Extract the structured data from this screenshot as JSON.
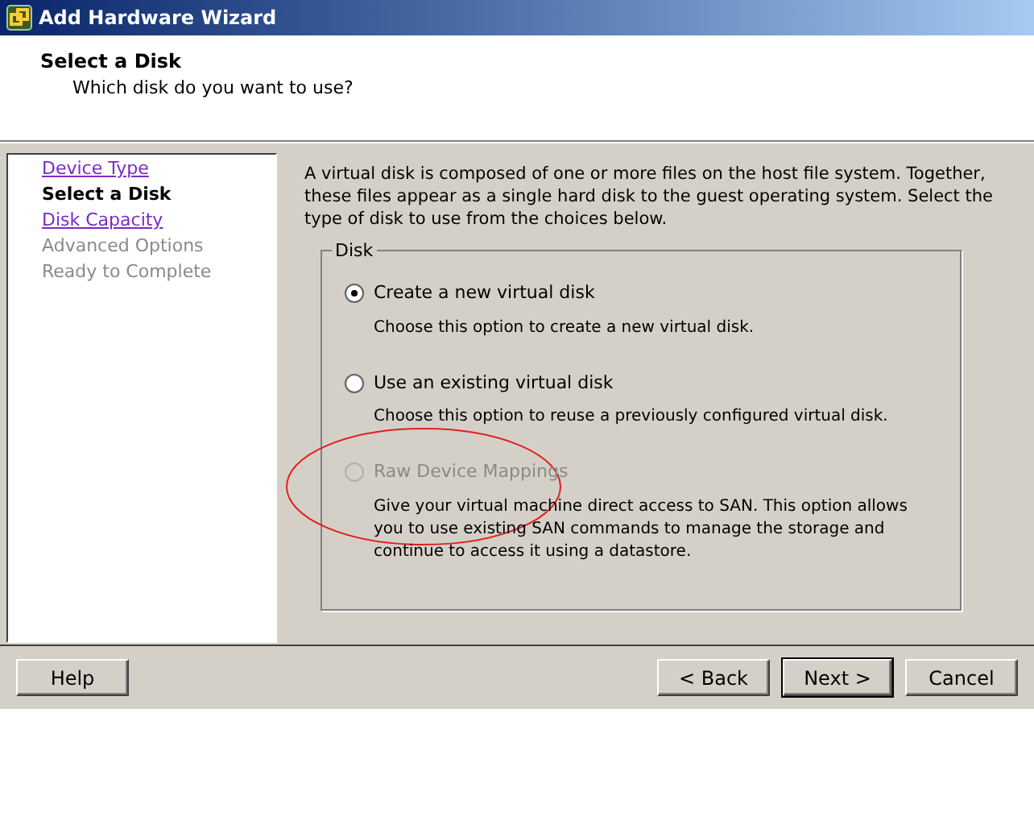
{
  "window": {
    "title": "Add Hardware Wizard"
  },
  "header": {
    "title": "Select a Disk",
    "subtitle": "Which disk do you want to use?"
  },
  "steps": [
    {
      "label": "Device Type",
      "kind": "link"
    },
    {
      "label": "Select a Disk",
      "kind": "current"
    },
    {
      "label": "Disk Capacity",
      "kind": "link"
    },
    {
      "label": "Advanced Options",
      "kind": "disabled"
    },
    {
      "label": "Ready to Complete",
      "kind": "disabled"
    }
  ],
  "intro": "A virtual disk is composed of one or more files on the host file system. Together, these files appear as a single hard disk to the guest operating system. Select the type of disk to use from the choices below.",
  "group": {
    "title": "Disk",
    "options": [
      {
        "label": "Create a new virtual disk",
        "description": "Choose this option to create a new virtual disk.",
        "selected": true,
        "disabled": false
      },
      {
        "label": "Use an existing virtual disk",
        "description": "Choose this option to reuse a previously configured virtual disk.",
        "selected": false,
        "disabled": false
      },
      {
        "label": "Raw Device Mappings",
        "description": "Give your virtual machine direct access to SAN. This option allows you to use existing SAN commands to manage the storage and continue to access it using a datastore.",
        "selected": false,
        "disabled": true
      }
    ]
  },
  "buttons": {
    "help": "Help",
    "back": "< Back",
    "next": "Next >",
    "cancel": "Cancel"
  }
}
